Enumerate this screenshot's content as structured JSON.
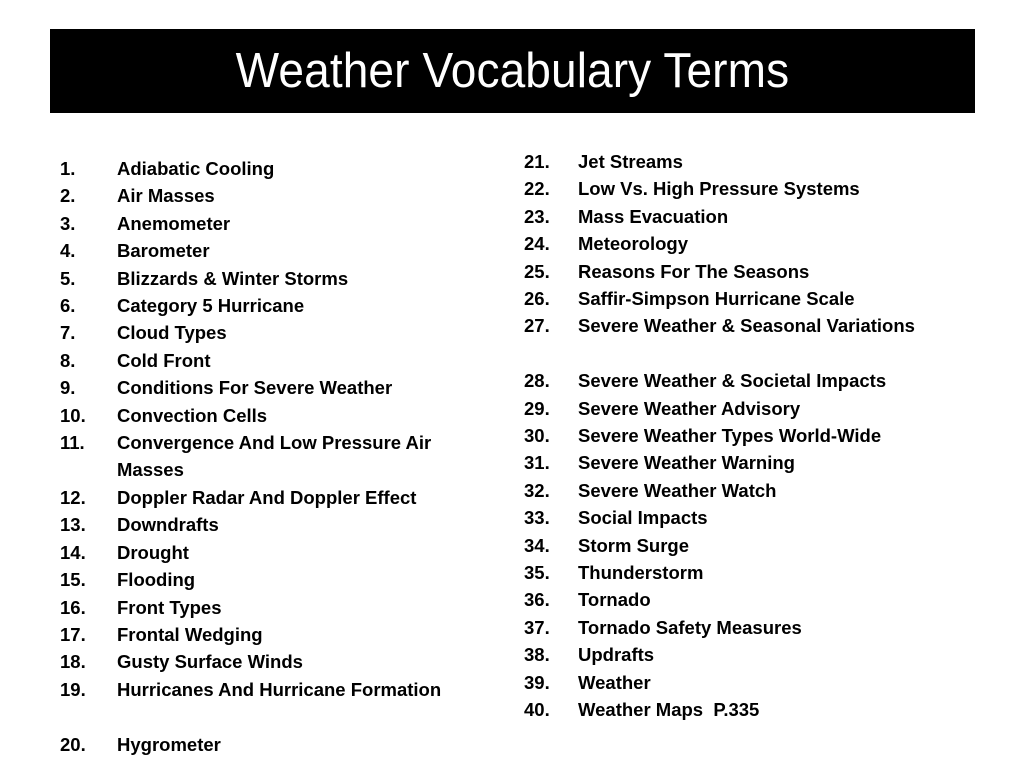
{
  "slide": {
    "background_color": "#FFFFFF",
    "title": {
      "text": "Weather Vocabulary Terms",
      "background_color": "#000000",
      "text_color": "#FFFFFF"
    }
  },
  "columns": {
    "left": {
      "items": [
        {
          "number": "1.",
          "label": "Adiabatic Cooling"
        },
        {
          "number": "2.",
          "label": "Air Masses"
        },
        {
          "number": "3.",
          "label": "Anemometer"
        },
        {
          "number": "4.",
          "label": "Barometer"
        },
        {
          "number": "5.",
          "label": "Blizzards & Winter Storms"
        },
        {
          "number": "6.",
          "label": "Category 5 Hurricane"
        },
        {
          "number": "7.",
          "label": "Cloud Types"
        },
        {
          "number": "8.",
          "label": "Cold Front"
        },
        {
          "number": "9.",
          "label": "Conditions For Severe Weather"
        },
        {
          "number": "10.",
          "label": "Convection Cells"
        },
        {
          "number": "11.",
          "label": "Convergence And Low Pressure Air Masses"
        },
        {
          "number": "12.",
          "label": "Doppler Radar And Doppler Effect"
        },
        {
          "number": "13.",
          "label": "Downdrafts"
        },
        {
          "number": "14.",
          "label": "Drought"
        },
        {
          "number": "15.",
          "label": "Flooding"
        },
        {
          "number": "16.",
          "label": "Front Types"
        },
        {
          "number": "17.",
          "label": "Frontal Wedging"
        },
        {
          "number": "18.",
          "label": "Gusty Surface Winds"
        },
        {
          "number": "19.",
          "label": "Hurricanes And Hurricane Formation"
        },
        {
          "number": "20.",
          "label": "Hygrometer"
        }
      ]
    },
    "right": {
      "items": [
        {
          "number": "21.",
          "label": "Jet Streams"
        },
        {
          "number": "22.",
          "label": "Low Vs. High Pressure Systems"
        },
        {
          "number": "23.",
          "label": "Mass Evacuation"
        },
        {
          "number": "24.",
          "label": "Meteorology"
        },
        {
          "number": "25.",
          "label": "Reasons For The Seasons"
        },
        {
          "number": "26.",
          "label": "Saffir-Simpson Hurricane Scale"
        },
        {
          "number": "27.",
          "label": "Severe Weather & Seasonal Variations"
        },
        {
          "number": "28.",
          "label": "Severe Weather & Societal Impacts"
        },
        {
          "number": "29.",
          "label": "Severe Weather Advisory"
        },
        {
          "number": "30.",
          "label": "Severe Weather Types World-Wide"
        },
        {
          "number": "31.",
          "label": "Severe Weather Warning"
        },
        {
          "number": "32.",
          "label": "Severe Weather Watch"
        },
        {
          "number": "33.",
          "label": "Social Impacts"
        },
        {
          "number": "34.",
          "label": "Storm Surge"
        },
        {
          "number": "35.",
          "label": "Thunderstorm"
        },
        {
          "number": "36.",
          "label": "Tornado"
        },
        {
          "number": "37.",
          "label": "Tornado Safety Measures"
        },
        {
          "number": "38.",
          "label": "Updrafts"
        },
        {
          "number": "39.",
          "label": "Weather"
        },
        {
          "number": "40.",
          "label": "Weather Maps  P.335"
        }
      ]
    }
  }
}
